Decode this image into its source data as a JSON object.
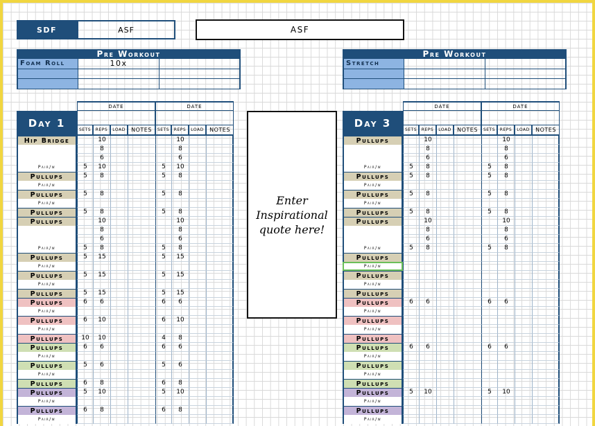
{
  "header": {
    "sdf_label": "SDF",
    "asf_value": "ASF",
    "title": "ASF"
  },
  "left_pre": {
    "heading": "Pre Workout",
    "rows": [
      {
        "label": "Foam Roll",
        "value": "10x"
      },
      {
        "label": "",
        "value": ""
      },
      {
        "label": "",
        "value": ""
      }
    ]
  },
  "right_pre": {
    "heading": "Pre Workout",
    "rows": [
      {
        "label": "Stretch",
        "value": ""
      },
      {
        "label": "",
        "value": ""
      },
      {
        "label": "",
        "value": ""
      }
    ]
  },
  "columns": {
    "date": "DATE",
    "sets": "SETS",
    "reps": "REPS",
    "load": "LOAD",
    "notes": "NOTES"
  },
  "quote": "Enter Inspirational quote here!",
  "left_day": {
    "title": "Day 1",
    "rows": [
      {
        "n": "Hip Bridge",
        "c": "tan",
        "a": [
          "",
          "10",
          "",
          ""
        ],
        "b": [
          "",
          "10",
          "",
          ""
        ]
      },
      {
        "n": "",
        "a": [
          "",
          "8",
          "",
          ""
        ],
        "b": [
          "",
          "8",
          "",
          ""
        ]
      },
      {
        "n": "",
        "a": [
          "",
          "6",
          "",
          ""
        ],
        "b": [
          "",
          "6",
          "",
          ""
        ]
      },
      {
        "n": "Pair/w",
        "a": [
          "5",
          "10",
          "",
          ""
        ],
        "b": [
          "5",
          "10",
          "",
          ""
        ]
      },
      {
        "n": "Pullups",
        "c": "tan",
        "a": [
          "5",
          "8",
          "",
          ""
        ],
        "b": [
          "5",
          "8",
          "",
          ""
        ]
      },
      {
        "n": "Pair/w",
        "a": [
          "",
          "",
          "",
          ""
        ],
        "b": [
          "",
          "",
          "",
          ""
        ]
      },
      {
        "n": "Pullups",
        "c": "tan",
        "a": [
          "5",
          "8",
          "",
          ""
        ],
        "b": [
          "5",
          "8",
          "",
          ""
        ]
      },
      {
        "n": "Pair/w",
        "a": [
          "",
          "",
          "",
          ""
        ],
        "b": [
          "",
          "",
          "",
          ""
        ]
      },
      {
        "n": "Pullups",
        "c": "tan",
        "a": [
          "5",
          "8",
          "",
          ""
        ],
        "b": [
          "5",
          "8",
          "",
          ""
        ]
      },
      {
        "n": "Pullups",
        "c": "tan",
        "a": [
          "",
          "10",
          "",
          ""
        ],
        "b": [
          "",
          "10",
          "",
          ""
        ]
      },
      {
        "n": "",
        "a": [
          "",
          "8",
          "",
          ""
        ],
        "b": [
          "",
          "8",
          "",
          ""
        ]
      },
      {
        "n": "",
        "a": [
          "",
          "6",
          "",
          ""
        ],
        "b": [
          "",
          "6",
          "",
          ""
        ]
      },
      {
        "n": "Pair/w",
        "a": [
          "5",
          "8",
          "",
          ""
        ],
        "b": [
          "5",
          "8",
          "",
          ""
        ]
      },
      {
        "n": "Pullups",
        "c": "tan",
        "a": [
          "5",
          "15",
          "",
          ""
        ],
        "b": [
          "5",
          "15",
          "",
          ""
        ]
      },
      {
        "n": "Pair/w",
        "a": [
          "",
          "",
          "",
          ""
        ],
        "b": [
          "",
          "",
          "",
          ""
        ]
      },
      {
        "n": "Pullups",
        "c": "tan",
        "a": [
          "5",
          "15",
          "",
          ""
        ],
        "b": [
          "5",
          "15",
          "",
          ""
        ]
      },
      {
        "n": "Pair/w",
        "a": [
          "",
          "",
          "",
          ""
        ],
        "b": [
          "",
          "",
          "",
          ""
        ]
      },
      {
        "n": "Pullups",
        "c": "tan",
        "a": [
          "5",
          "15",
          "",
          ""
        ],
        "b": [
          "5",
          "15",
          "",
          ""
        ]
      },
      {
        "n": "Pullups",
        "c": "pink",
        "a": [
          "6",
          "6",
          "",
          ""
        ],
        "b": [
          "6",
          "6",
          "",
          ""
        ]
      },
      {
        "n": "Pair/w",
        "a": [
          "",
          "",
          "",
          ""
        ],
        "b": [
          "",
          "",
          "",
          ""
        ]
      },
      {
        "n": "Pullups",
        "c": "pink",
        "a": [
          "6",
          "10",
          "",
          ""
        ],
        "b": [
          "6",
          "10",
          "",
          ""
        ]
      },
      {
        "n": "Pair/w",
        "a": [
          "",
          "",
          "",
          ""
        ],
        "b": [
          "",
          "",
          "",
          ""
        ]
      },
      {
        "n": "Pullups",
        "c": "pink",
        "a": [
          "10",
          "10",
          "",
          ""
        ],
        "b": [
          "4",
          "8",
          "",
          ""
        ]
      },
      {
        "n": "Pullups",
        "c": "green",
        "a": [
          "6",
          "6",
          "",
          ""
        ],
        "b": [
          "6",
          "6",
          "",
          ""
        ]
      },
      {
        "n": "Pair/w",
        "a": [
          "",
          "",
          "",
          ""
        ],
        "b": [
          "",
          "",
          "",
          ""
        ]
      },
      {
        "n": "Pullups",
        "c": "green",
        "a": [
          "5",
          "6",
          "",
          ""
        ],
        "b": [
          "5",
          "6",
          "",
          ""
        ]
      },
      {
        "n": "Pair/w",
        "a": [
          "",
          "",
          "",
          ""
        ],
        "b": [
          "",
          "",
          "",
          ""
        ]
      },
      {
        "n": "Pullups",
        "c": "green",
        "a": [
          "6",
          "8",
          "",
          ""
        ],
        "b": [
          "6",
          "8",
          "",
          ""
        ]
      },
      {
        "n": "Pullups",
        "c": "purple",
        "a": [
          "5",
          "10",
          "",
          ""
        ],
        "b": [
          "5",
          "10",
          "",
          ""
        ]
      },
      {
        "n": "Pair/w",
        "a": [
          "",
          "",
          "",
          ""
        ],
        "b": [
          "",
          "",
          "",
          ""
        ]
      },
      {
        "n": "Pullups",
        "c": "purple",
        "a": [
          "6",
          "8",
          "",
          ""
        ],
        "b": [
          "6",
          "8",
          "",
          ""
        ]
      },
      {
        "n": "Pair/w",
        "a": [
          "",
          "",
          "",
          ""
        ],
        "b": [
          "",
          "",
          "",
          ""
        ]
      }
    ]
  },
  "right_day": {
    "title": "Day 3",
    "rows": [
      {
        "n": "Pullups",
        "c": "tan",
        "a": [
          "",
          "10",
          "",
          ""
        ],
        "b": [
          "",
          "10",
          "",
          ""
        ]
      },
      {
        "n": "",
        "a": [
          "",
          "8",
          "",
          ""
        ],
        "b": [
          "",
          "8",
          "",
          ""
        ]
      },
      {
        "n": "",
        "a": [
          "",
          "6",
          "",
          ""
        ],
        "b": [
          "",
          "6",
          "",
          ""
        ]
      },
      {
        "n": "Pair/w",
        "a": [
          "5",
          "8",
          "",
          ""
        ],
        "b": [
          "5",
          "8",
          "",
          ""
        ]
      },
      {
        "n": "Pullups",
        "c": "tan",
        "a": [
          "5",
          "8",
          "",
          ""
        ],
        "b": [
          "5",
          "8",
          "",
          ""
        ]
      },
      {
        "n": "Pair/w",
        "a": [
          "",
          "",
          "",
          ""
        ],
        "b": [
          "",
          "",
          "",
          ""
        ]
      },
      {
        "n": "Pullups",
        "c": "tan",
        "a": [
          "5",
          "8",
          "",
          ""
        ],
        "b": [
          "5",
          "8",
          "",
          ""
        ]
      },
      {
        "n": "Pair/w",
        "a": [
          "",
          "",
          "",
          ""
        ],
        "b": [
          "",
          "",
          "",
          ""
        ]
      },
      {
        "n": "Pullups",
        "c": "tan",
        "a": [
          "5",
          "8",
          "",
          ""
        ],
        "b": [
          "5",
          "8",
          "",
          ""
        ]
      },
      {
        "n": "Pullups",
        "c": "tan",
        "a": [
          "",
          "10",
          "",
          ""
        ],
        "b": [
          "",
          "10",
          "",
          ""
        ]
      },
      {
        "n": "",
        "a": [
          "",
          "8",
          "",
          ""
        ],
        "b": [
          "",
          "8",
          "",
          ""
        ]
      },
      {
        "n": "",
        "a": [
          "",
          "6",
          "",
          ""
        ],
        "b": [
          "",
          "6",
          "",
          ""
        ]
      },
      {
        "n": "Pair/w",
        "a": [
          "5",
          "8",
          "",
          ""
        ],
        "b": [
          "5",
          "8",
          "",
          ""
        ]
      },
      {
        "n": "Pullups",
        "c": "tan",
        "a": [
          "",
          "",
          "",
          ""
        ],
        "b": [
          "",
          "",
          "",
          ""
        ]
      },
      {
        "n": "Pair/w",
        "a": [
          "",
          "",
          "",
          ""
        ],
        "b": [
          "",
          "",
          "",
          ""
        ]
      },
      {
        "n": "Pullups",
        "c": "tan",
        "a": [
          "",
          "",
          "",
          ""
        ],
        "b": [
          "",
          "",
          "",
          ""
        ]
      },
      {
        "n": "Pair/w",
        "a": [
          "",
          "",
          "",
          ""
        ],
        "b": [
          "",
          "",
          "",
          ""
        ]
      },
      {
        "n": "Pullups",
        "c": "tan",
        "a": [
          "",
          "",
          "",
          ""
        ],
        "b": [
          "",
          "",
          "",
          ""
        ]
      },
      {
        "n": "Pullups",
        "c": "pink",
        "a": [
          "6",
          "6",
          "",
          ""
        ],
        "b": [
          "6",
          "6",
          "",
          ""
        ]
      },
      {
        "n": "Pair/w",
        "a": [
          "",
          "",
          "",
          ""
        ],
        "b": [
          "",
          "",
          "",
          ""
        ]
      },
      {
        "n": "Pullups",
        "c": "pink",
        "a": [
          "",
          "",
          "",
          ""
        ],
        "b": [
          "",
          "",
          "",
          ""
        ]
      },
      {
        "n": "Pair/w",
        "a": [
          "",
          "",
          "",
          ""
        ],
        "b": [
          "",
          "",
          "",
          ""
        ]
      },
      {
        "n": "Pullups",
        "c": "pink",
        "a": [
          "",
          "",
          "",
          ""
        ],
        "b": [
          "",
          "",
          "",
          ""
        ]
      },
      {
        "n": "Pullups",
        "c": "green",
        "a": [
          "6",
          "6",
          "",
          ""
        ],
        "b": [
          "6",
          "6",
          "",
          ""
        ]
      },
      {
        "n": "Pair/w",
        "a": [
          "",
          "",
          "",
          ""
        ],
        "b": [
          "",
          "",
          "",
          ""
        ]
      },
      {
        "n": "Pullups",
        "c": "green",
        "a": [
          "",
          "",
          "",
          ""
        ],
        "b": [
          "",
          "",
          "",
          ""
        ]
      },
      {
        "n": "Pair/w",
        "a": [
          "",
          "",
          "",
          ""
        ],
        "b": [
          "",
          "",
          "",
          ""
        ]
      },
      {
        "n": "Pullups",
        "c": "green",
        "a": [
          "",
          "",
          "",
          ""
        ],
        "b": [
          "",
          "",
          "",
          ""
        ]
      },
      {
        "n": "Pullups",
        "c": "purple",
        "a": [
          "5",
          "10",
          "",
          ""
        ],
        "b": [
          "5",
          "10",
          "",
          ""
        ]
      },
      {
        "n": "Pair/w",
        "a": [
          "",
          "",
          "",
          ""
        ],
        "b": [
          "",
          "",
          "",
          ""
        ]
      },
      {
        "n": "Pullups",
        "c": "purple",
        "a": [
          "",
          "",
          "",
          ""
        ],
        "b": [
          "",
          "",
          "",
          ""
        ]
      },
      {
        "n": "Pair/w",
        "a": [
          "",
          "",
          "",
          ""
        ],
        "b": [
          "",
          "",
          "",
          ""
        ]
      }
    ]
  },
  "colors": {
    "navy": "#1f4e7a",
    "label_blue": "#8db4e2",
    "tan": "#d6cfb4",
    "pink": "#efc1c1",
    "green": "#cfdfb3",
    "purple": "#c3b4d8",
    "selection": "#6bbf59"
  },
  "selected_cell": {
    "panel": "right",
    "row": 14
  }
}
